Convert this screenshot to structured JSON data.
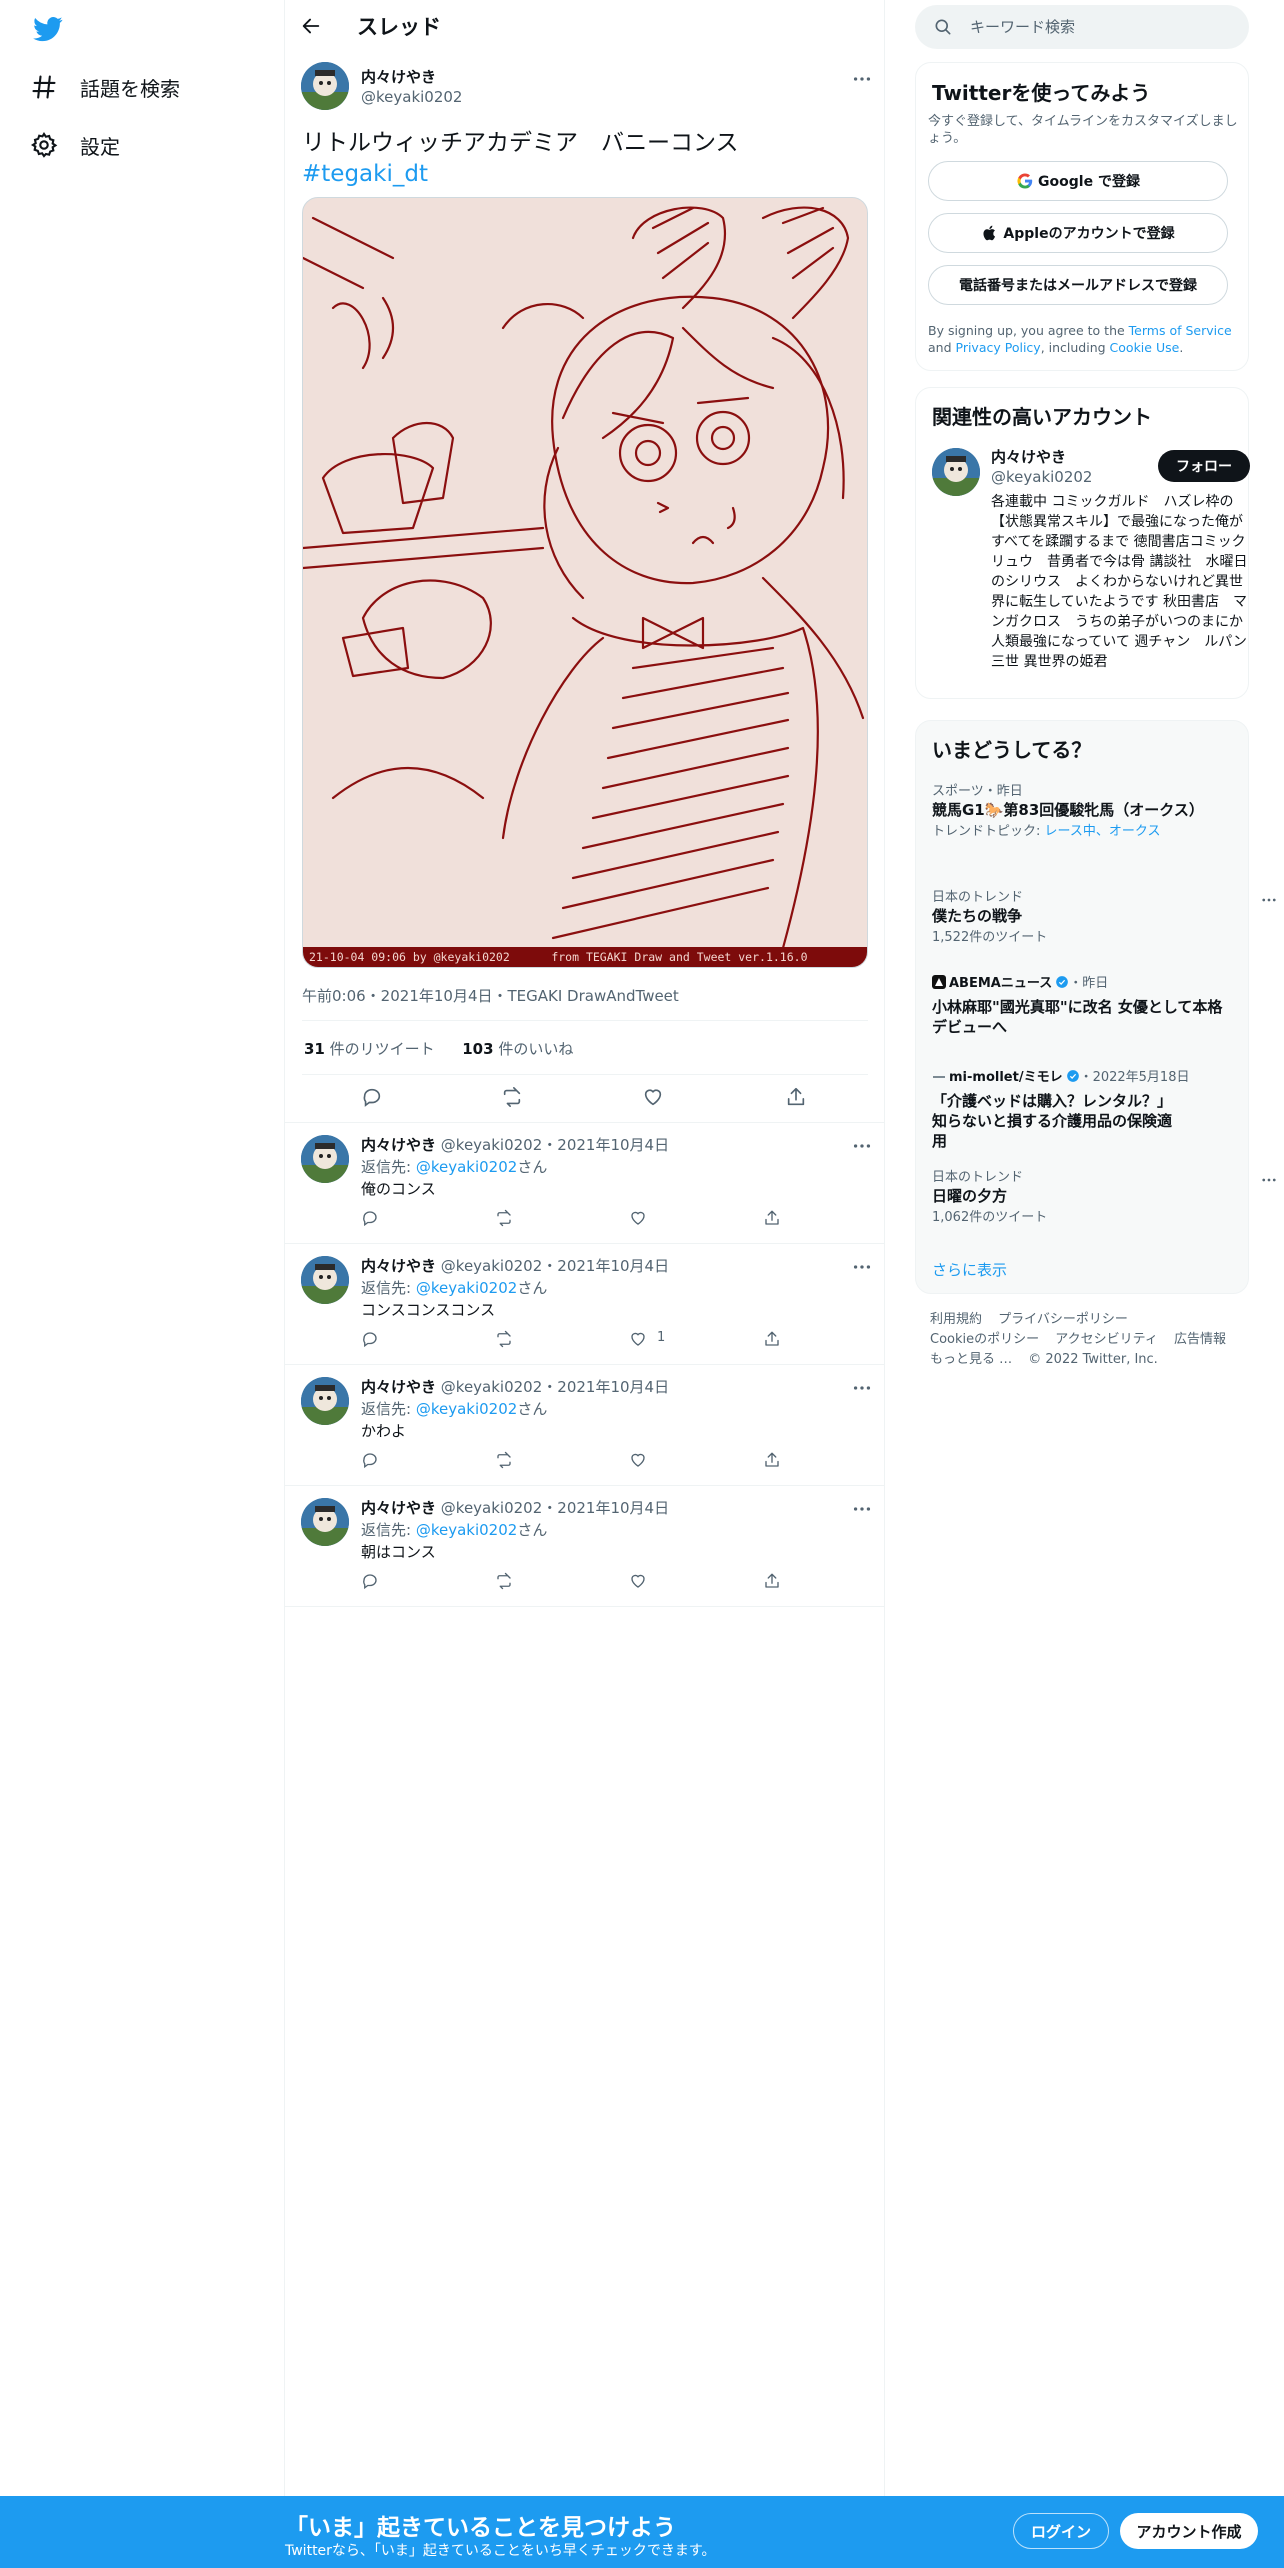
{
  "brand": {
    "accent": "#1d9bf0",
    "text": "#0f1419",
    "muted": "#536471",
    "border": "#eff3f4"
  },
  "nav": {
    "logo_icon": "twitter-bird-icon",
    "items": [
      {
        "label": "話題を検索",
        "icon": "hashtag-icon"
      },
      {
        "label": "設定",
        "icon": "gear-icon"
      }
    ]
  },
  "header": {
    "title": "スレッド",
    "back_icon": "arrow-left-icon"
  },
  "tweet": {
    "author_name": "内々けやき",
    "author_handle": "@keyaki0202",
    "text": "リトルウィッチアカデミア　バニーコンス",
    "hashtag": "#tegaki_dt",
    "image_caption": "21-10-04 09:06 by @keyaki0202      from TEGAKI Draw and Tweet ver.1.16.0",
    "meta": "午前0:06・2021年10月4日・TEGAKI DrawAndTweet",
    "retweets": "31",
    "retweets_label": "件のリツイート",
    "likes": "103",
    "likes_label": "件のいいね"
  },
  "replies": [
    {
      "name": "内々けやき",
      "handle": "@keyaki0202",
      "date": "2021年10月4日",
      "to_prefix": "返信先: ",
      "to_handle": "@keyaki0202",
      "to_suffix": "さん",
      "text": "俺のコンス",
      "likes": ""
    },
    {
      "name": "内々けやき",
      "handle": "@keyaki0202",
      "date": "2021年10月4日",
      "to_prefix": "返信先: ",
      "to_handle": "@keyaki0202",
      "to_suffix": "さん",
      "text": "コンスコンスコンス",
      "likes": "1"
    },
    {
      "name": "内々けやき",
      "handle": "@keyaki0202",
      "date": "2021年10月4日",
      "to_prefix": "返信先: ",
      "to_handle": "@keyaki0202",
      "to_suffix": "さん",
      "text": "かわよ",
      "likes": ""
    },
    {
      "name": "内々けやき",
      "handle": "@keyaki0202",
      "date": "2021年10月4日",
      "to_prefix": "返信先: ",
      "to_handle": "@keyaki0202",
      "to_suffix": "さん",
      "text": "朝はコンス",
      "likes": ""
    }
  ],
  "search": {
    "placeholder": "キーワード検索"
  },
  "signup": {
    "title": "Twitterを使ってみよう",
    "subtitle": "今すぐ登録して、タイムラインをカスタマイズしましょう。",
    "google": "Google で登録",
    "apple": "Appleのアカウントで登録",
    "phone": "電話番号またはメールアドレスで登録",
    "terms_prefix": "By signing up, you agree to the ",
    "terms_tos": "Terms of Service",
    "terms_and": " and ",
    "terms_privacy": "Privacy Policy",
    "terms_including": ", including ",
    "terms_cookie": "Cookie Use",
    "terms_end": "."
  },
  "related": {
    "title": "関連性の高いアカウント",
    "name": "内々けやき",
    "handle": "@keyaki0202",
    "follow": "フォロー",
    "bio": "各連載中 コミックガルド　ハズレ枠の【状態異常スキル】で最強になった俺がすべてを蹂躙するまで 徳間書店コミックリュウ　昔勇者で今は骨 講談社　水曜日のシリウス　よくわからないけれど異世界に転生していたようです 秋田書店　マンガクロス　うちの弟子がいつのまにか人類最強になっていて 週チャン　ルパン三世 異世界の姫君"
  },
  "trends": {
    "title": "いまどうしてる？",
    "items": [
      {
        "context": "スポーツ・昨日",
        "title": "競馬G1🐎第83回優駿牝馬（オークス）",
        "sub_prefix": "トレンドトピック: ",
        "sub_link": "レース中、オークス"
      },
      {
        "context": "日本のトレンド",
        "title": "僕たちの戦争",
        "sub": "1,522件のツイート"
      },
      {
        "source": "ABEMAニュース",
        "time": "・昨日",
        "title": "小林麻耶\"國光真耶\"に改名 女優として本格デビューへ"
      },
      {
        "source": "mi-mollet/ミモレ",
        "time": "・2022年5月18日",
        "title": "「介護ベッドは購入？レンタル？」知らないと損する介護用品の保険適用"
      },
      {
        "context": "日本のトレンド",
        "title": "日曜の夕方",
        "sub": "1,062件のツイート"
      }
    ],
    "show_more": "さらに表示"
  },
  "footer": {
    "links": [
      "利用規約",
      "プライバシーポリシー",
      "Cookieのポリシー",
      "アクセシビリティ",
      "広告情報",
      "もっと見る …",
      "© 2022 Twitter, Inc."
    ]
  },
  "bottom_bar": {
    "title": "「いま」起きていることを見つけよう",
    "subtitle": "Twitterなら、「いま」起きていることをいち早くチェックできます。",
    "login": "ログイン",
    "signup": "アカウント作成"
  }
}
